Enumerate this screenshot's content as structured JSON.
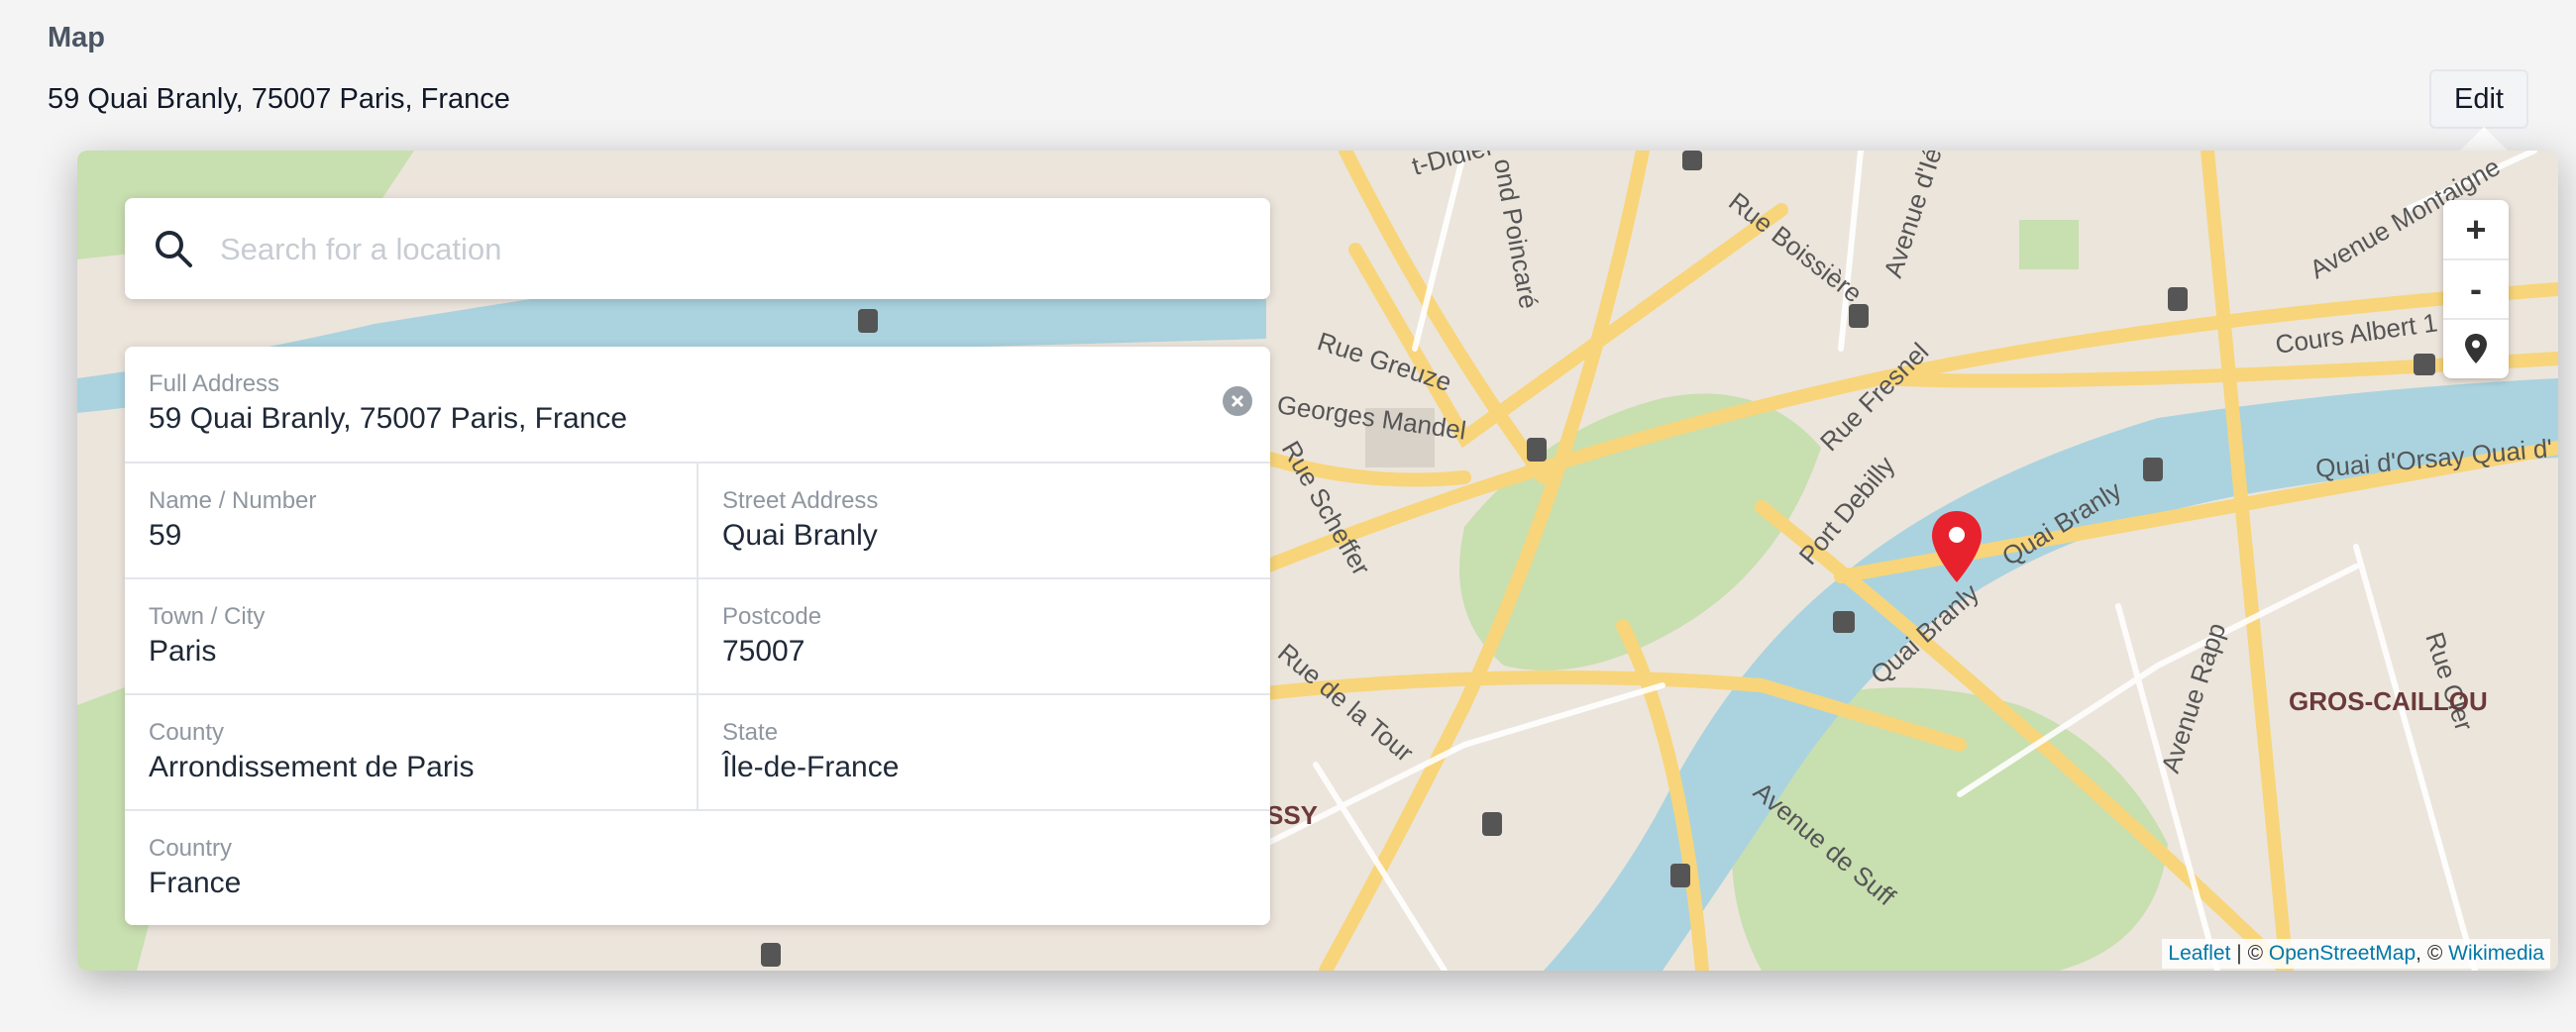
{
  "field": {
    "label": "Map",
    "value": "59 Quai Branly, 75007 Paris, France"
  },
  "edit_button": "Edit",
  "search": {
    "placeholder": "Search for a location",
    "value": ""
  },
  "address": {
    "full": {
      "label": "Full Address",
      "value": "59 Quai Branly, 75007 Paris, France"
    },
    "name_number": {
      "label": "Name / Number",
      "value": "59"
    },
    "street": {
      "label": "Street Address",
      "value": "Quai Branly"
    },
    "town": {
      "label": "Town / City",
      "value": "Paris"
    },
    "postcode": {
      "label": "Postcode",
      "value": "75007"
    },
    "county": {
      "label": "County",
      "value": "Arrondissement de Paris"
    },
    "state": {
      "label": "State",
      "value": "Île-de-France"
    },
    "country": {
      "label": "Country",
      "value": "France"
    }
  },
  "map_controls": {
    "zoom_in": "+",
    "zoom_out": "-",
    "locate_icon": "location-pin-icon"
  },
  "attribution": {
    "leaflet": "Leaflet",
    "separator": " | © ",
    "osm": "OpenStreetMap",
    "comma": ", © ",
    "wikimedia": "Wikimedia"
  },
  "map_labels": {
    "rue_greuze": "Rue Greuze",
    "georges_mandel": "Georges Mandel",
    "rue_boissiere": "Rue Boissière",
    "avenue_iena": "Avenue d'Iéna",
    "rue_fresnel": "Rue Fresnel",
    "port_debilly": "Port Debilly",
    "cours_albert": "Cours Albert 1",
    "quai_orsay": "Quai d'Orsay Quai d'",
    "quai_branly_1": "Quai Branly",
    "quai_branly_2": "Quai Branly",
    "gros_caillou": "GROS-CAILLOU",
    "avenue_rapp": "Avenue Rapp",
    "rue_cler": "Rue Cler",
    "rue_de_la_tour": "Rue de la Tour",
    "avenue_de_suffren": "Avenue de Suff",
    "avenue_montaigne": "Avenue Montaigne",
    "rue_scheffer": "Rue Scheffer",
    "passy": "SSY",
    "saint_didier": "t-Didier",
    "raymond_poincare": "ond Poincaré"
  },
  "colors": {
    "marker": "#e8222c",
    "water": "#aad3df",
    "park": "#c8dfb0",
    "road": "#f8d57a"
  }
}
